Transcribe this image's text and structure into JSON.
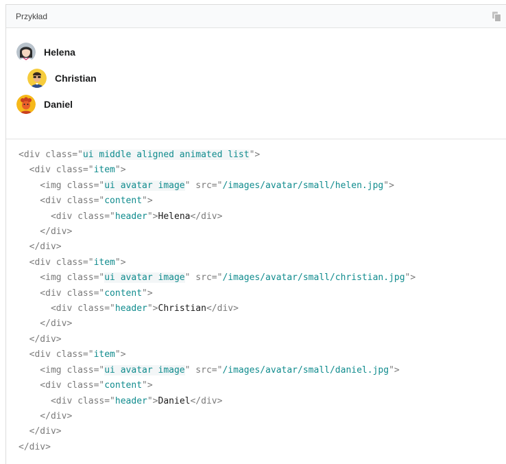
{
  "example": {
    "title": "Przykład",
    "copy_icon": "copy-icon"
  },
  "list": {
    "items": [
      {
        "name": "Helena",
        "avatar_icon": "female-avatar"
      },
      {
        "name": "Christian",
        "avatar_icon": "male-avatar-sunglasses"
      },
      {
        "name": "Daniel",
        "avatar_icon": "male-avatar-curly-hair"
      }
    ]
  },
  "code": {
    "lines": [
      [
        {
          "t": "tag",
          "v": "<div class=\""
        },
        {
          "t": "hl",
          "v": "ui middle aligned animated list"
        },
        {
          "t": "tag",
          "v": "\">"
        }
      ],
      [
        {
          "t": "tag",
          "v": "  <div class=\""
        },
        {
          "t": "val",
          "v": "item"
        },
        {
          "t": "tag",
          "v": "\">"
        }
      ],
      [
        {
          "t": "tag",
          "v": "    <img class=\""
        },
        {
          "t": "hl",
          "v": "ui avatar image"
        },
        {
          "t": "tag",
          "v": "\" src=\""
        },
        {
          "t": "val",
          "v": "/images/avatar/small/helen.jpg"
        },
        {
          "t": "tag",
          "v": "\">"
        }
      ],
      [
        {
          "t": "tag",
          "v": "    <div class=\""
        },
        {
          "t": "val",
          "v": "content"
        },
        {
          "t": "tag",
          "v": "\">"
        }
      ],
      [
        {
          "t": "tag",
          "v": "      <div class=\""
        },
        {
          "t": "val",
          "v": "header"
        },
        {
          "t": "tag",
          "v": "\">"
        },
        {
          "t": "txt",
          "v": "Helena"
        },
        {
          "t": "tag",
          "v": "</div>"
        }
      ],
      [
        {
          "t": "tag",
          "v": "    </div>"
        }
      ],
      [
        {
          "t": "tag",
          "v": "  </div>"
        }
      ],
      [
        {
          "t": "tag",
          "v": "  <div class=\""
        },
        {
          "t": "val",
          "v": "item"
        },
        {
          "t": "tag",
          "v": "\">"
        }
      ],
      [
        {
          "t": "tag",
          "v": "    <img class=\""
        },
        {
          "t": "hl",
          "v": "ui avatar image"
        },
        {
          "t": "tag",
          "v": "\" src=\""
        },
        {
          "t": "val",
          "v": "/images/avatar/small/christian.jpg"
        },
        {
          "t": "tag",
          "v": "\">"
        }
      ],
      [
        {
          "t": "tag",
          "v": "    <div class=\""
        },
        {
          "t": "val",
          "v": "content"
        },
        {
          "t": "tag",
          "v": "\">"
        }
      ],
      [
        {
          "t": "tag",
          "v": "      <div class=\""
        },
        {
          "t": "val",
          "v": "header"
        },
        {
          "t": "tag",
          "v": "\">"
        },
        {
          "t": "txt",
          "v": "Christian"
        },
        {
          "t": "tag",
          "v": "</div>"
        }
      ],
      [
        {
          "t": "tag",
          "v": "    </div>"
        }
      ],
      [
        {
          "t": "tag",
          "v": "  </div>"
        }
      ],
      [
        {
          "t": "tag",
          "v": "  <div class=\""
        },
        {
          "t": "val",
          "v": "item"
        },
        {
          "t": "tag",
          "v": "\">"
        }
      ],
      [
        {
          "t": "tag",
          "v": "    <img class=\""
        },
        {
          "t": "hl",
          "v": "ui avatar image"
        },
        {
          "t": "tag",
          "v": "\" src=\""
        },
        {
          "t": "val",
          "v": "/images/avatar/small/daniel.jpg"
        },
        {
          "t": "tag",
          "v": "\">"
        }
      ],
      [
        {
          "t": "tag",
          "v": "    <div class=\""
        },
        {
          "t": "val",
          "v": "content"
        },
        {
          "t": "tag",
          "v": "\">"
        }
      ],
      [
        {
          "t": "tag",
          "v": "      <div class=\""
        },
        {
          "t": "val",
          "v": "header"
        },
        {
          "t": "tag",
          "v": "\">"
        },
        {
          "t": "txt",
          "v": "Daniel"
        },
        {
          "t": "tag",
          "v": "</div>"
        }
      ],
      [
        {
          "t": "tag",
          "v": "    </div>"
        }
      ],
      [
        {
          "t": "tag",
          "v": "  </div>"
        }
      ],
      [
        {
          "t": "tag",
          "v": "</div>"
        }
      ]
    ]
  }
}
